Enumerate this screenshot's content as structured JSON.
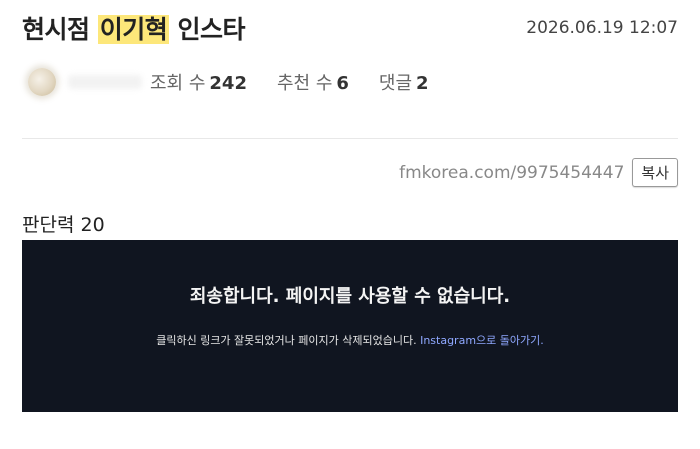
{
  "post": {
    "title_prefix": "현시점 ",
    "title_highlight": "이기혁",
    "title_suffix": " 인스타",
    "date": "2026.06.19 12:07"
  },
  "meta": {
    "views_label": "조회 수",
    "views": "242",
    "likes_label": "추천 수",
    "likes": "6",
    "comments_label": "댓글",
    "comments": "2"
  },
  "link": {
    "url": "fmkorea.com/9975454447",
    "copy_label": "복사"
  },
  "body": {
    "judgement": "판단력 20"
  },
  "embed": {
    "title": "죄송합니다. 페이지를 사용할 수 없습니다.",
    "message": "클릭하신 링크가 잘못되었거나 페이지가 삭제되었습니다. ",
    "link_text": "Instagram으로 돌아가기.",
    "link_color": "#8fa8ff",
    "background": "#101520"
  }
}
